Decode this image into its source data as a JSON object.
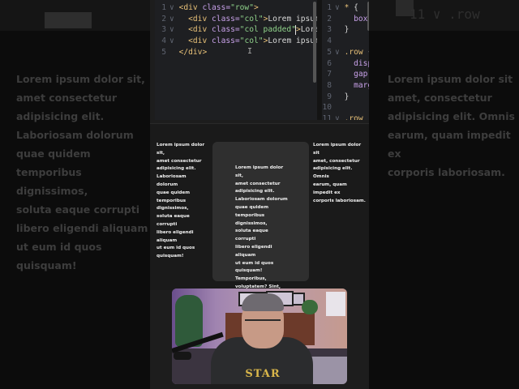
{
  "background": {
    "left_text": "Lorem ipsum dolor sit,\namet consectetur\nadipisicing elit.\nLaboriosam dolorum\nquae quidem\ntemporibus dignissimos,\nsoluta eaque corrupti\nlibero eligendi aliquam\nut eum id quos\nquisquam!",
    "right_text": "Lorem ipsum dolor sit\namet, consectetur\nadipisicing elit. Omnis\nearum, quam impedit ex\ncorporis laboriosam.",
    "top_right_fragment": "11 ∨ .row"
  },
  "editor": {
    "html_lines": [
      {
        "n": "1",
        "fold": "∨",
        "tag_open": "<div ",
        "attr": "class=",
        "str": "\"row\"",
        "tag_close": ">",
        "text": ""
      },
      {
        "n": "2",
        "fold": "∨",
        "tag_open": "<div ",
        "attr": "class=",
        "str": "\"col\"",
        "tag_close": ">",
        "text": "Lorem ipsum do"
      },
      {
        "n": "3",
        "fold": "∨",
        "tag_open": "<div ",
        "attr": "class=",
        "str": "\"col padded\"",
        "tag_close": ">",
        "text": "Lorem i"
      },
      {
        "n": "4",
        "fold": "∨",
        "tag_open": "<div ",
        "attr": "class=",
        "str": "\"col\"",
        "tag_close": ">",
        "text": "Lorem ipsum do"
      },
      {
        "n": "5",
        "fold": "",
        "tag_open": "</div>",
        "attr": "",
        "str": "",
        "tag_close": "",
        "text": ""
      }
    ],
    "css_lines": [
      {
        "n": "1",
        "fold": "∨",
        "sel": "* ",
        "rest": "{"
      },
      {
        "n": "2",
        "fold": "",
        "sel": "",
        "rest": "  box-"
      },
      {
        "n": "3",
        "fold": "",
        "sel": "",
        "rest": "}"
      },
      {
        "n": "4",
        "fold": "",
        "sel": "",
        "rest": ""
      },
      {
        "n": "5",
        "fold": "∨",
        "sel": ".row ",
        "rest": "{"
      },
      {
        "n": "6",
        "fold": "",
        "sel": "",
        "rest": "  disp"
      },
      {
        "n": "7",
        "fold": "",
        "sel": "",
        "rest": "  gap:"
      },
      {
        "n": "8",
        "fold": "",
        "sel": "",
        "rest": "  marg"
      },
      {
        "n": "9",
        "fold": "",
        "sel": "",
        "rest": "}"
      },
      {
        "n": "10",
        "fold": "",
        "sel": "",
        "rest": ""
      },
      {
        "n": "11",
        "fold": "∨",
        "sel": ".row",
        "rest": ""
      }
    ],
    "cursor_glyph": "I"
  },
  "preview": {
    "col1": "Lorem ipsum dolor sit,\namet consectetur\nadipisicing elit.\nLaboriosam dolorum\nquae quidem\ntemporibus dignissimos,\nsoluta eaque corrupti\nlibero eligendi aliquam\nut eum id quos\nquisquam!",
    "col2": "Lorem ipsum dolor sit,\namet consectetur\nadipisicing elit.\nLaboriosam dolorum\nquae quidem\ntemporibus dignissimos,\nsoluta eaque corrupti\nlibero eligendi aliquam\nut eum id quos\nquisquam! Temporibus,\nvoluptatem? Sint,\nconsequuntur odio?",
    "col3": "Lorem ipsum dolor sit\namet, consectetur\nadipisicing elit. Omnis\nearum, quam impedit ex\ncorporis laboriosam."
  },
  "webcam": {
    "shirt_logo": "STAR"
  },
  "colors": {
    "tag": "#e8c178",
    "attr": "#c7a0e8",
    "string": "#8fd18a",
    "background": "#0c0c0c"
  }
}
